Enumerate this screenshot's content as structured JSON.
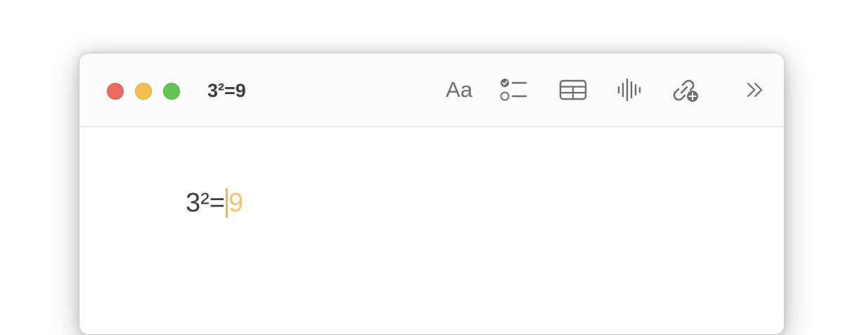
{
  "window": {
    "title": "3²=9"
  },
  "toolbar": {
    "format_label": "Aa",
    "icons": [
      "checklist-icon",
      "table-icon",
      "audio-icon",
      "link-add-icon",
      "more-icon"
    ]
  },
  "note": {
    "typed_text": "3²=",
    "suggestion": "9"
  },
  "colors": {
    "close": "#ed6a5e",
    "minimize": "#f5bf4f",
    "zoom": "#62c554",
    "caret": "#f1b93e",
    "suggestion": "#f4c56a"
  }
}
